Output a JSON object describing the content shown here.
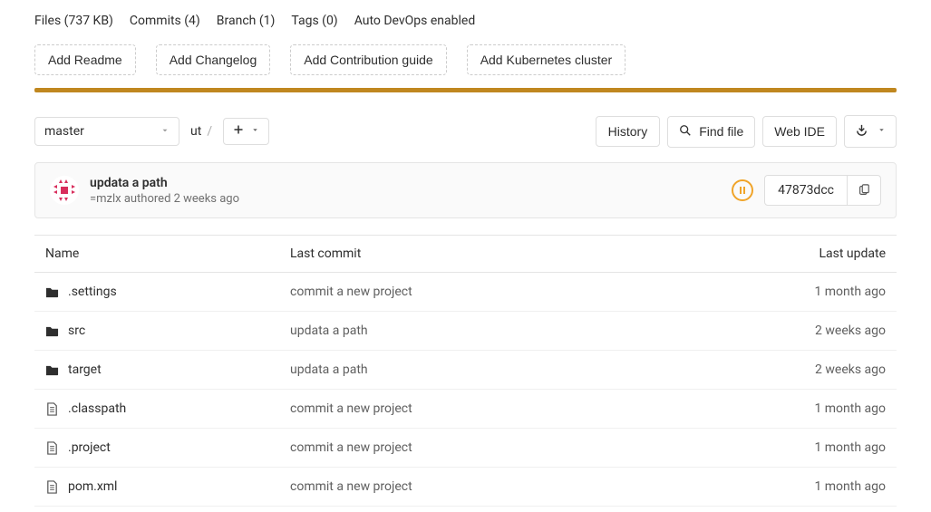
{
  "metaLinks": {
    "files": "Files (737 KB)",
    "commits": "Commits (4)",
    "branch": "Branch (1)",
    "tags": "Tags (0)",
    "devops": "Auto DevOps enabled"
  },
  "actionButtons": {
    "readme": "Add Readme",
    "changelog": "Add Changelog",
    "contributing": "Add Contribution guide",
    "k8s": "Add Kubernetes cluster"
  },
  "toolbar": {
    "branch": "master",
    "breadcrumb_root": "ut",
    "history": "History",
    "find_file": "Find file",
    "web_ide": "Web IDE"
  },
  "commit": {
    "title": "updata a path",
    "meta": "=mzlx authored 2 weeks ago",
    "sha": "47873dcc"
  },
  "tableHeaders": {
    "name": "Name",
    "last_commit": "Last commit",
    "last_update": "Last update"
  },
  "files": [
    {
      "type": "folder",
      "name": ".settings",
      "commit": "commit a new project",
      "update": "1 month ago"
    },
    {
      "type": "folder",
      "name": "src",
      "commit": "updata a path",
      "update": "2 weeks ago"
    },
    {
      "type": "folder",
      "name": "target",
      "commit": "updata a path",
      "update": "2 weeks ago"
    },
    {
      "type": "file",
      "name": ".classpath",
      "commit": "commit a new project",
      "update": "1 month ago"
    },
    {
      "type": "file",
      "name": ".project",
      "commit": "commit a new project",
      "update": "1 month ago"
    },
    {
      "type": "file",
      "name": "pom.xml",
      "commit": "commit a new project",
      "update": "1 month ago"
    }
  ]
}
